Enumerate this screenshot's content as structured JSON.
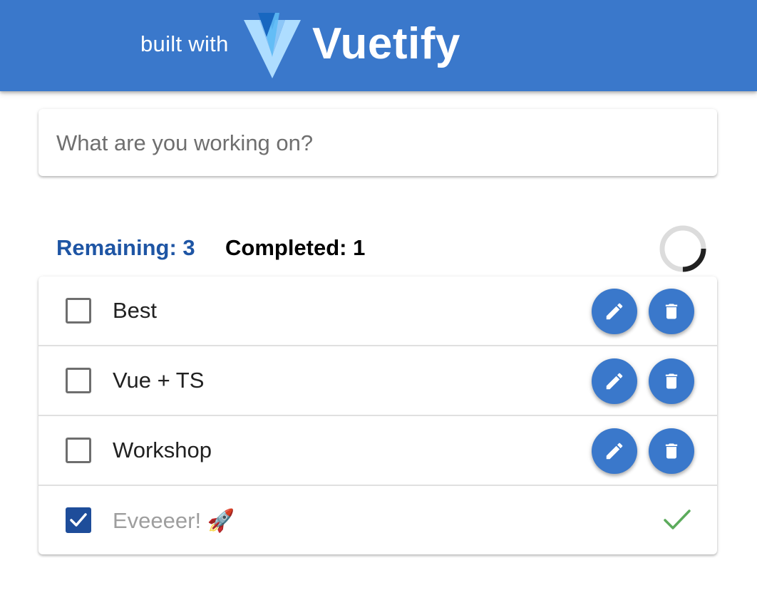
{
  "header": {
    "built_with": "built with",
    "brand": "Vuetify",
    "background_color": "#3a78cb"
  },
  "new_task": {
    "placeholder": "What are you working on?",
    "value": ""
  },
  "stats": {
    "remaining_label": "Remaining: 3",
    "completed_label": "Completed: 1",
    "remaining_color": "#1e55a4",
    "progress_fraction": 0.25
  },
  "tasks": [
    {
      "label": "Best",
      "done": false,
      "actions": [
        "pencil-icon",
        "trash-icon"
      ]
    },
    {
      "label": "Vue + TS",
      "done": false,
      "actions": [
        "pencil-icon",
        "trash-icon"
      ]
    },
    {
      "label": "Workshop",
      "done": false,
      "actions": [
        "pencil-icon",
        "trash-icon"
      ]
    },
    {
      "label": "Eveeeer! 🚀",
      "done": true,
      "status_icon": "checkmark-icon"
    }
  ],
  "colors": {
    "accent": "#3a78cb",
    "checked": "#1e4d9a",
    "success": "#5cab5c"
  }
}
